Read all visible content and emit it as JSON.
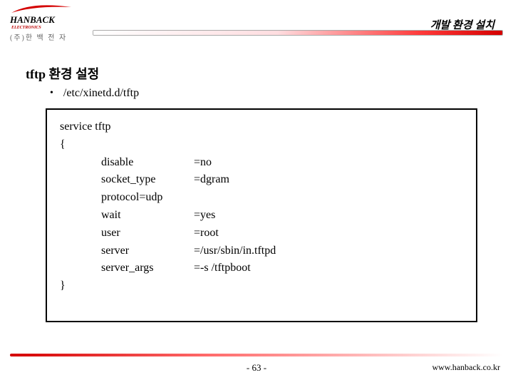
{
  "header": {
    "brand_en": "HANBACK",
    "brand_sub": "ELECTRONICS",
    "brand_ko": "(주)한 백 전 자",
    "chapter_title": "개발 환경 설치"
  },
  "section": {
    "title": "tftp 환경 설정",
    "file_path": "/etc/xinetd.d/tftp"
  },
  "code": {
    "line1": "service tftp",
    "open": "{",
    "rows": [
      {
        "key": "disable",
        "val": "=no"
      },
      {
        "key": "socket_type",
        "val": "=dgram"
      },
      {
        "key": "protocol=udp",
        "val": ""
      },
      {
        "key": "wait",
        "val": "=yes"
      },
      {
        "key": "user",
        "val": "=root"
      },
      {
        "key": "server",
        "val": "=/usr/sbin/in.tftpd"
      },
      {
        "key": "server_args",
        "val": "=-s /tftpboot"
      }
    ],
    "close": "}"
  },
  "footer": {
    "page": "- 63 -",
    "site": "www.hanback.co.kr"
  }
}
